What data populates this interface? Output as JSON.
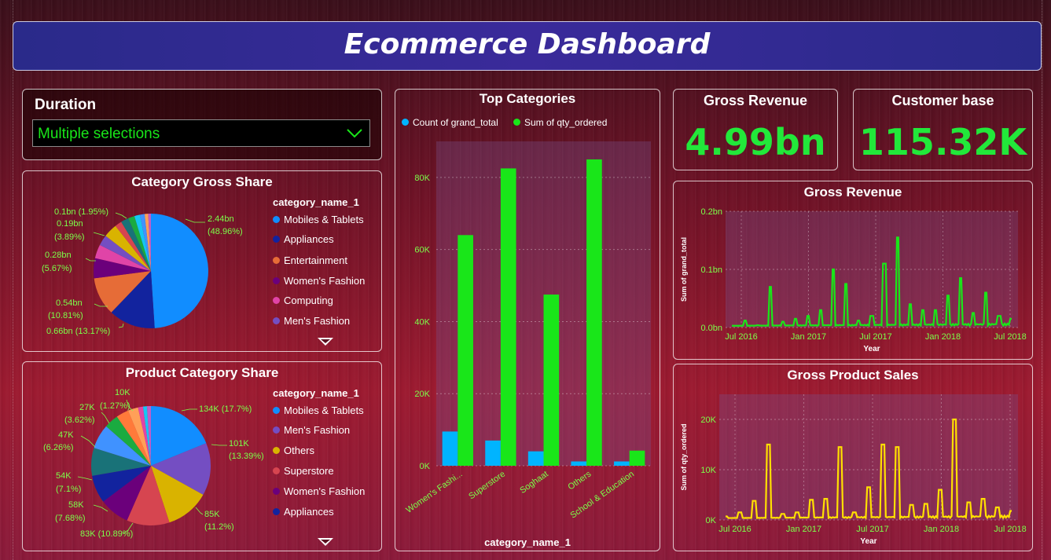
{
  "header": {
    "title": "Ecommerce Dashboard"
  },
  "duration": {
    "label": "Duration",
    "value": "Multiple selections"
  },
  "category_gross_share": {
    "title": "Category Gross Share",
    "legend_title": "category_name_1",
    "legend": [
      {
        "name": "Mobiles & Tablets",
        "color": "#118dff"
      },
      {
        "name": "Appliances",
        "color": "#12239e"
      },
      {
        "name": "Entertainment",
        "color": "#e66c37"
      },
      {
        "name": "Women's Fashion",
        "color": "#6b007b"
      },
      {
        "name": "Computing",
        "color": "#e044a7"
      },
      {
        "name": "Men's Fashion",
        "color": "#744ec2"
      }
    ],
    "labels": [
      "2.44bn",
      "(48.96%)",
      "0.66bn (13.17%)",
      "0.54bn",
      "(10.81%)",
      "0.28bn",
      "(5.67%)",
      "0.19bn",
      "(3.89%)",
      "0.1bn (1.95%)"
    ]
  },
  "product_category_share": {
    "title": "Product Category Share",
    "legend_title": "category_name_1",
    "legend": [
      {
        "name": "Mobiles & Tablets",
        "color": "#118dff"
      },
      {
        "name": "Men's Fashion",
        "color": "#744ec2"
      },
      {
        "name": "Others",
        "color": "#d9b300"
      },
      {
        "name": "Superstore",
        "color": "#d64550"
      },
      {
        "name": "Women's Fashion",
        "color": "#6b007b"
      },
      {
        "name": "Appliances",
        "color": "#12239e"
      }
    ],
    "labels": [
      "134K (17.7%)",
      "101K",
      "(13.39%)",
      "85K",
      "(11.2%)",
      "83K (10.89%)",
      "58K",
      "(7.68%)",
      "54K",
      "(7.1%)",
      "47K",
      "(6.26%)",
      "27K",
      "(3.62%)",
      "10K",
      "(1.27%)"
    ]
  },
  "top_categories": {
    "title": "Top Categories",
    "legend": [
      {
        "name": "Count of grand_total",
        "color": "#00b4ff"
      },
      {
        "name": "Sum of qty_ordered",
        "color": "#19e619"
      }
    ],
    "xlabel": "category_name_1"
  },
  "kpis": {
    "gross_revenue": {
      "label": "Gross Revenue",
      "value": "4.99bn"
    },
    "customer_base": {
      "label": "Customer base",
      "value": "115.32K"
    }
  },
  "chart_data": [
    {
      "type": "bar",
      "title": "Top Categories",
      "categories": [
        "Women's Fashi...",
        "Superstore",
        "Soghaat",
        "Others",
        "School & Education"
      ],
      "series": [
        {
          "name": "Count of grand_total",
          "values": [
            9500,
            7000,
            4000,
            1200,
            1200
          ]
        },
        {
          "name": "Sum of qty_ordered",
          "values": [
            64000,
            82500,
            47500,
            85000,
            4200
          ]
        }
      ],
      "xlabel": "category_name_1",
      "ylabel": "",
      "ylim": [
        0,
        90000
      ],
      "yticks": [
        "0K",
        "20K",
        "40K",
        "60K",
        "80K"
      ],
      "legend": "top-left",
      "colors": [
        "#00b4ff",
        "#19e619"
      ]
    },
    {
      "type": "line",
      "title": "Gross Revenue",
      "xlabel": "Year",
      "ylabel": "Sum of grand_total",
      "xticks": [
        "Jul 2016",
        "Jan 2017",
        "Jul 2017",
        "Jan 2018",
        "Jul 2018"
      ],
      "yticks": [
        "0.0bn",
        "0.1bn",
        "0.2bn"
      ],
      "ylim": [
        0,
        0.2
      ],
      "color": "#19e619",
      "x": [
        "Jul 2016",
        "Sep 2016",
        "Nov 2016",
        "Dec 2016",
        "Jan 2017",
        "Mar 2017",
        "May 2017",
        "Jun 2017",
        "Jul 2017",
        "Aug 2017",
        "Sep 2017",
        "Oct 2017",
        "Nov 2017",
        "Nov 2017",
        "Dec 2017",
        "Jan 2018",
        "Feb 2018",
        "Mar 2018",
        "Apr 2018",
        "May 2018",
        "Jun 2018",
        "Jul 2018",
        "Aug 2018"
      ],
      "y": [
        0.003,
        0.012,
        0.004,
        0.07,
        0.01,
        0.015,
        0.02,
        0.03,
        0.1,
        0.075,
        0.012,
        0.02,
        0.11,
        0.155,
        0.04,
        0.03,
        0.03,
        0.055,
        0.085,
        0.025,
        0.06,
        0.02,
        0.015
      ]
    },
    {
      "type": "line",
      "title": "Gross Product Sales",
      "xlabel": "Year",
      "ylabel": "Sum of qty_ordered",
      "xticks": [
        "Jul 2016",
        "Jan 2017",
        "Jul 2017",
        "Jan 2018",
        "Jul 2018"
      ],
      "yticks": [
        "0K",
        "10K",
        "20K"
      ],
      "ylim": [
        0,
        25000
      ],
      "color": "#ffe000",
      "x": [
        "Jul 2016",
        "Sep 2016",
        "Oct 2016",
        "Nov 2016",
        "Dec 2016",
        "Mar 2017",
        "May 2017",
        "Jun 2017",
        "Jul 2017",
        "Aug 2017",
        "Sep 2017",
        "Nov 2017",
        "Nov 2017",
        "Dec 2017",
        "Feb 2018",
        "Mar 2018",
        "Apr 2018",
        "May 2018",
        "Jun 2018",
        "Jul 2018",
        "Aug 2018"
      ],
      "y": [
        700,
        1500,
        3800,
        15000,
        1200,
        1500,
        4000,
        4200,
        14500,
        1500,
        6500,
        15000,
        14500,
        3000,
        3200,
        6000,
        20000,
        3500,
        4200,
        2500,
        1800
      ]
    }
  ]
}
